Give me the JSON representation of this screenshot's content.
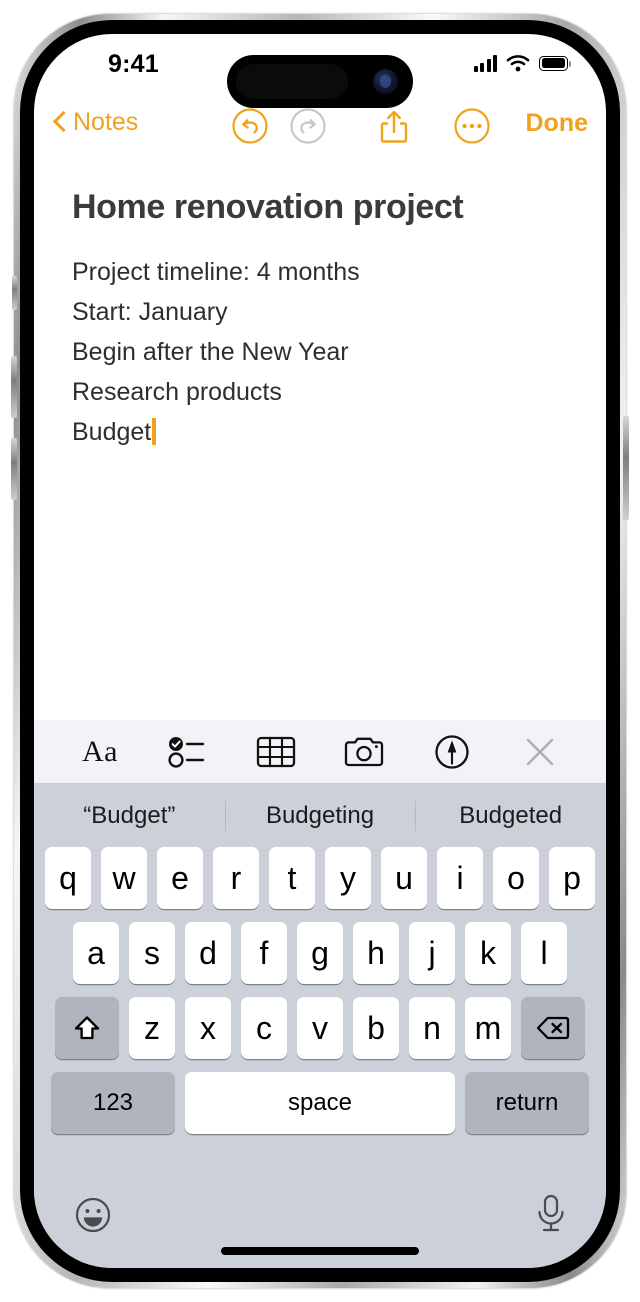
{
  "status_bar": {
    "time": "9:41",
    "signal_icon": "cellular-signal-icon",
    "wifi_icon": "wifi-icon",
    "battery_icon": "battery-full-icon"
  },
  "nav_bar": {
    "back_label": "Notes",
    "back_icon": "chevron-left-icon",
    "undo_icon": "undo-icon",
    "redo_icon": "redo-icon",
    "share_icon": "share-icon",
    "more_icon": "ellipsis-circle-icon",
    "done_label": "Done",
    "accent_color": "#EFA21D",
    "disabled_color": "#C7C7CC"
  },
  "note": {
    "title": "Home renovation project",
    "lines": [
      "Project timeline: 4 months",
      "Start: January",
      "Begin after the New Year",
      "Research products",
      "Budget"
    ],
    "cursor_after_line_index": 4,
    "cursor_color": "#EFA21D"
  },
  "format_toolbar": {
    "items": [
      {
        "name": "format-text-button",
        "label": "Aa",
        "icon": "text-format-icon"
      },
      {
        "name": "checklist-button",
        "label": "",
        "icon": "checklist-icon"
      },
      {
        "name": "table-button",
        "label": "",
        "icon": "table-icon"
      },
      {
        "name": "camera-button",
        "label": "",
        "icon": "camera-icon"
      },
      {
        "name": "markup-button",
        "label": "",
        "icon": "markup-pen-icon"
      },
      {
        "name": "close-toolbar-button",
        "label": "",
        "icon": "close-x-icon"
      }
    ],
    "background_color": "#F3F3F7"
  },
  "keyboard": {
    "predictions": [
      "“Budget”",
      "Budgeting",
      "Budgeted"
    ],
    "row1": [
      "q",
      "w",
      "e",
      "r",
      "t",
      "y",
      "u",
      "i",
      "o",
      "p"
    ],
    "row2": [
      "a",
      "s",
      "d",
      "f",
      "g",
      "h",
      "j",
      "k",
      "l"
    ],
    "row3": [
      "z",
      "x",
      "c",
      "v",
      "b",
      "n",
      "m"
    ],
    "shift_icon": "shift-arrow-icon",
    "backspace_icon": "backspace-delete-icon",
    "numbers_label": "123",
    "space_label": "space",
    "return_label": "return",
    "emoji_icon": "emoji-smiley-icon",
    "mic_icon": "microphone-icon",
    "background_color": "#CCD0D9",
    "key_color": "#FFFFFF",
    "modifier_key_color": "#AFB4BE"
  }
}
